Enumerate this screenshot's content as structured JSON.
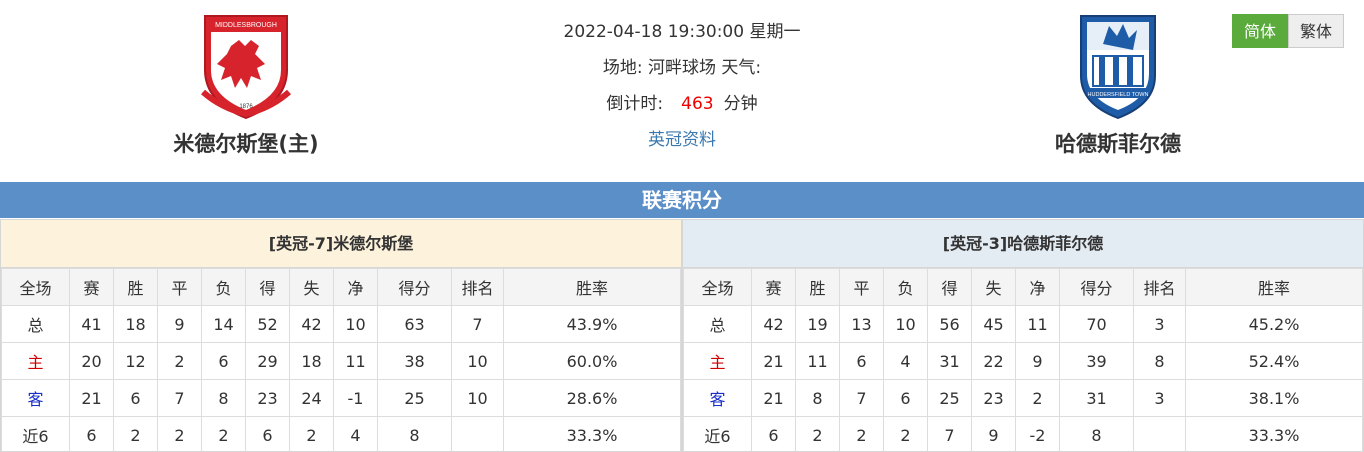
{
  "header": {
    "datetime": "2022-04-18 19:30:00 星期一",
    "venue_label": "场地:",
    "venue": "河畔球场",
    "weather_label": "天气:",
    "countdown_label": "倒计时:",
    "countdown_value": "463",
    "countdown_unit": "分钟",
    "league_link": "英冠资料"
  },
  "home_team": {
    "name": "米德尔斯堡(主)",
    "crest_text": "MIDDLESBROUGH",
    "crest_year": "1876",
    "crest_color": "#d7232c"
  },
  "away_team": {
    "name": "哈德斯菲尔德",
    "crest_text": "HUDDERSFIELD TOWN",
    "crest_color": "#1f5ca8"
  },
  "lang": {
    "simplified": "简体",
    "traditional": "繁体"
  },
  "standings": {
    "title": "联赛积分",
    "columns": [
      "全场",
      "赛",
      "胜",
      "平",
      "负",
      "得",
      "失",
      "净",
      "得分",
      "排名",
      "胜率"
    ],
    "home": {
      "title": "[英冠-7]米德尔斯堡",
      "rows": [
        [
          "总",
          "41",
          "18",
          "9",
          "14",
          "52",
          "42",
          "10",
          "63",
          "7",
          "43.9%"
        ],
        [
          "主",
          "20",
          "12",
          "2",
          "6",
          "29",
          "18",
          "11",
          "38",
          "10",
          "60.0%"
        ],
        [
          "客",
          "21",
          "6",
          "7",
          "8",
          "23",
          "24",
          "-1",
          "25",
          "10",
          "28.6%"
        ],
        [
          "近6",
          "6",
          "2",
          "2",
          "2",
          "6",
          "2",
          "4",
          "8",
          "",
          "33.3%"
        ]
      ]
    },
    "away": {
      "title": "[英冠-3]哈德斯菲尔德",
      "rows": [
        [
          "总",
          "42",
          "19",
          "13",
          "10",
          "56",
          "45",
          "11",
          "70",
          "3",
          "45.2%"
        ],
        [
          "主",
          "21",
          "11",
          "6",
          "4",
          "31",
          "22",
          "9",
          "39",
          "8",
          "52.4%"
        ],
        [
          "客",
          "21",
          "8",
          "7",
          "6",
          "25",
          "23",
          "2",
          "31",
          "3",
          "38.1%"
        ],
        [
          "近6",
          "6",
          "2",
          "2",
          "2",
          "7",
          "9",
          "-2",
          "8",
          "",
          "33.3%"
        ]
      ]
    }
  }
}
